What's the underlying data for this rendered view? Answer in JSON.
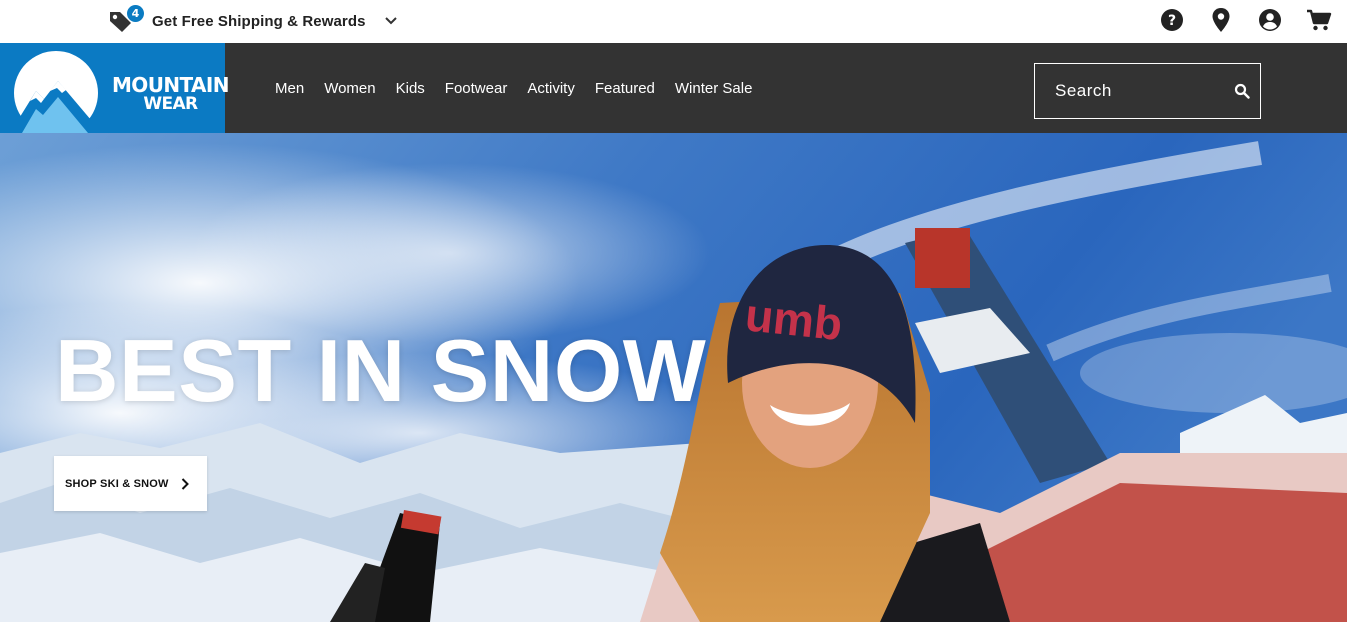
{
  "promo": {
    "badge_count": "4",
    "text": "Get Free Shipping & Rewards",
    "icon": "tag-icon",
    "chevron_icon": "chevron-down-icon"
  },
  "utility_icons": [
    "help-icon",
    "location-pin-icon",
    "account-icon",
    "cart-icon"
  ],
  "brand": {
    "line1": "MOUNTAIN",
    "line2": "WEAR",
    "color": "#0b7ac3"
  },
  "nav": {
    "items": [
      {
        "label": "Men"
      },
      {
        "label": "Women"
      },
      {
        "label": "Kids"
      },
      {
        "label": "Footwear"
      },
      {
        "label": "Activity"
      },
      {
        "label": "Featured"
      },
      {
        "label": "Winter Sale"
      }
    ],
    "background": "#333333"
  },
  "search": {
    "placeholder": "Search",
    "icon": "search-icon"
  },
  "hero": {
    "title": "BEST IN SNOW",
    "cta_label": "SHOP SKI & SNOW",
    "beanie_text": "umb"
  }
}
